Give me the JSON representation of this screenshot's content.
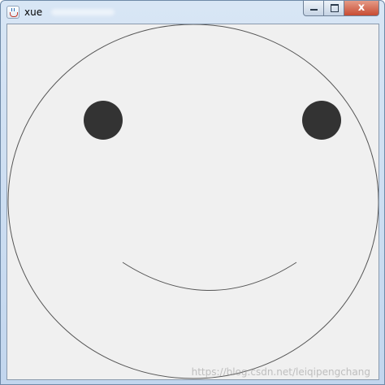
{
  "window": {
    "title": "xue",
    "controls": {
      "minimize_label": "",
      "maximize_label": "",
      "close_label": "x"
    }
  },
  "canvas": {
    "face_stroke_color": "#555555",
    "eye_color": "#333333",
    "background_color": "#f0f0f0"
  },
  "watermark": "https://blog.csdn.net/leiqipengchang"
}
